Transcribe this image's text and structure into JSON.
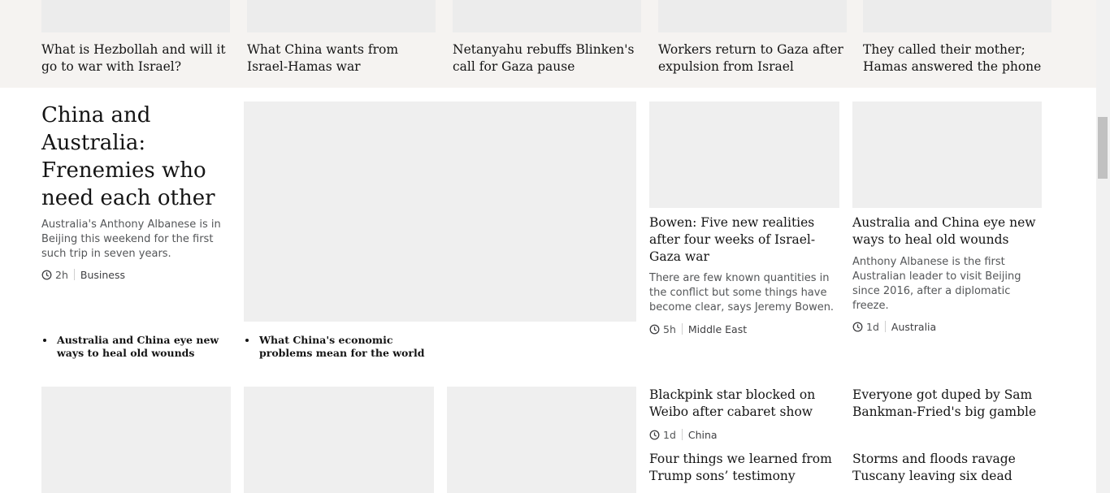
{
  "top_strip": {
    "stories": [
      {
        "title": "What is Hezbollah and will it go to war with Israel?"
      },
      {
        "title": "What China wants from Israel-Hamas war"
      },
      {
        "title": "Netanyahu rebuffs Blinken's call for Gaza pause"
      },
      {
        "title": "Workers return to Gaza after expulsion from Israel"
      },
      {
        "title": "They called their mother; Hamas answered the phone"
      }
    ]
  },
  "feature": {
    "headline": "China and Australia: Frenemies who need each other",
    "summary": "Australia's Anthony Albanese is in Beijing this weekend for the first such trip in seven years.",
    "time": "2h",
    "section": "Business",
    "related": [
      {
        "title": "Australia and China eye new ways to heal old wounds"
      },
      {
        "title": "What China's economic problems mean for the world"
      }
    ]
  },
  "cards": [
    {
      "headline": "Bowen: Five new realities after four weeks of Israel-Gaza war",
      "summary": "There are few known quantities in the conflict but some things have become clear, says Jeremy Bowen.",
      "time": "5h",
      "section": "Middle East"
    },
    {
      "headline": "Australia and China eye new ways to heal old wounds",
      "summary": "Anthony Albanese is the first Australian leader to visit Beijing since 2016, after a diplomatic freeze.",
      "time": "1d",
      "section": "Australia"
    }
  ],
  "small_stories": [
    {
      "headline": "Blackpink star blocked on Weibo after cabaret show",
      "time": "1d",
      "section": "China"
    },
    {
      "headline": "Everyone got duped by Sam Bankman-Fried's big gamble"
    },
    {
      "headline": "Four things we learned from Trump sons’ testimony"
    },
    {
      "headline": "Storms and floods ravage Tuscany leaving six dead"
    }
  ],
  "icons": {
    "clock": "clock-icon"
  },
  "colors": {
    "strip_background": "#f5f3f1",
    "placeholder": "#efefef",
    "text": "#141414",
    "summary_text": "#545658"
  }
}
